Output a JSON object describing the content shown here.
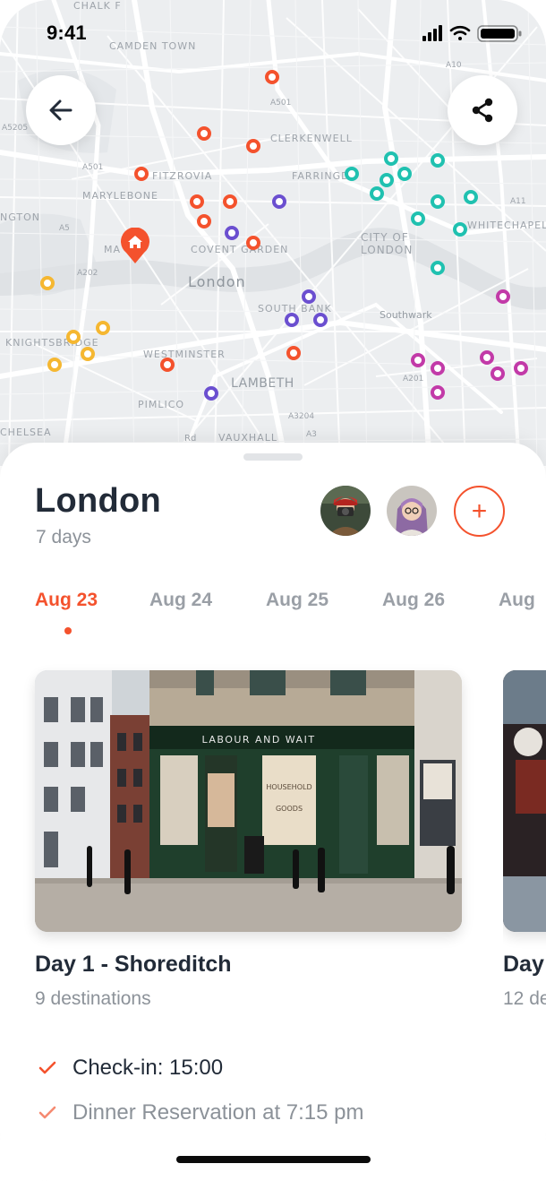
{
  "status_bar": {
    "time": "9:41"
  },
  "map": {
    "labels": {
      "chalk_farm": "CHALK F",
      "camden_town": "CAMDEN TOWN",
      "clerkenwell": "CLERKENWELL",
      "fitzrovia": "FITZROVIA",
      "farringdon": "FARRINGD",
      "marylebone": "MARYLEBONE",
      "city_of_london_1": "CITY OF",
      "city_of_london_2": "LONDON",
      "whitechapel": "WHITECHAPEL",
      "covent_garden": "COVENT GARDEN",
      "mayfair": "MA",
      "london": "London",
      "south_bank": "SOUTH BANK",
      "southwark": "Southwark",
      "knightsbridge": "KNIGHTSBRIDGE",
      "westminster": "WESTMINSTER",
      "lambeth": "LAMBETH",
      "pimlico": "PIMLICO",
      "chelsea": "CHELSEA",
      "vauxhall": "VAUXHALL",
      "ngton": "NGTON",
      "a501": "A501",
      "a501b": "A501",
      "a5": "A5",
      "a10": "A10",
      "a11": "A11",
      "a201": "A201",
      "a3": "A3",
      "a3204": "A3204",
      "a202": "A202",
      "a5205": "A5205",
      "rd": "Rd"
    },
    "pin_colors": {
      "orange": "#f4522d",
      "teal": "#20c1b0",
      "purple": "#6b4fd0",
      "magenta": "#c23aa8",
      "yellow": "#f5b731"
    },
    "home_icon": "home-icon"
  },
  "top_buttons": {
    "back_icon": "arrow-left-icon",
    "share_icon": "share-icon"
  },
  "trip": {
    "title": "London",
    "duration": "7 days",
    "add_icon": "+"
  },
  "dates": [
    "Aug 23",
    "Aug 24",
    "Aug 25",
    "Aug 26",
    "Aug"
  ],
  "active_date_index": 0,
  "days": [
    {
      "title": "Day 1 - Shoreditch",
      "subtitle": "9 destinations",
      "shop_sign": "LABOUR AND WAIT",
      "window_text_1": "HOUSEHOLD",
      "window_text_2": "GOODS",
      "items": [
        "Check-in: 15:00",
        "Dinner Reservation at 7:15 pm"
      ]
    },
    {
      "title": "Day",
      "subtitle": "12 de"
    }
  ],
  "colors": {
    "accent": "#f4522d",
    "text": "#222b38",
    "muted": "#8c9299"
  }
}
